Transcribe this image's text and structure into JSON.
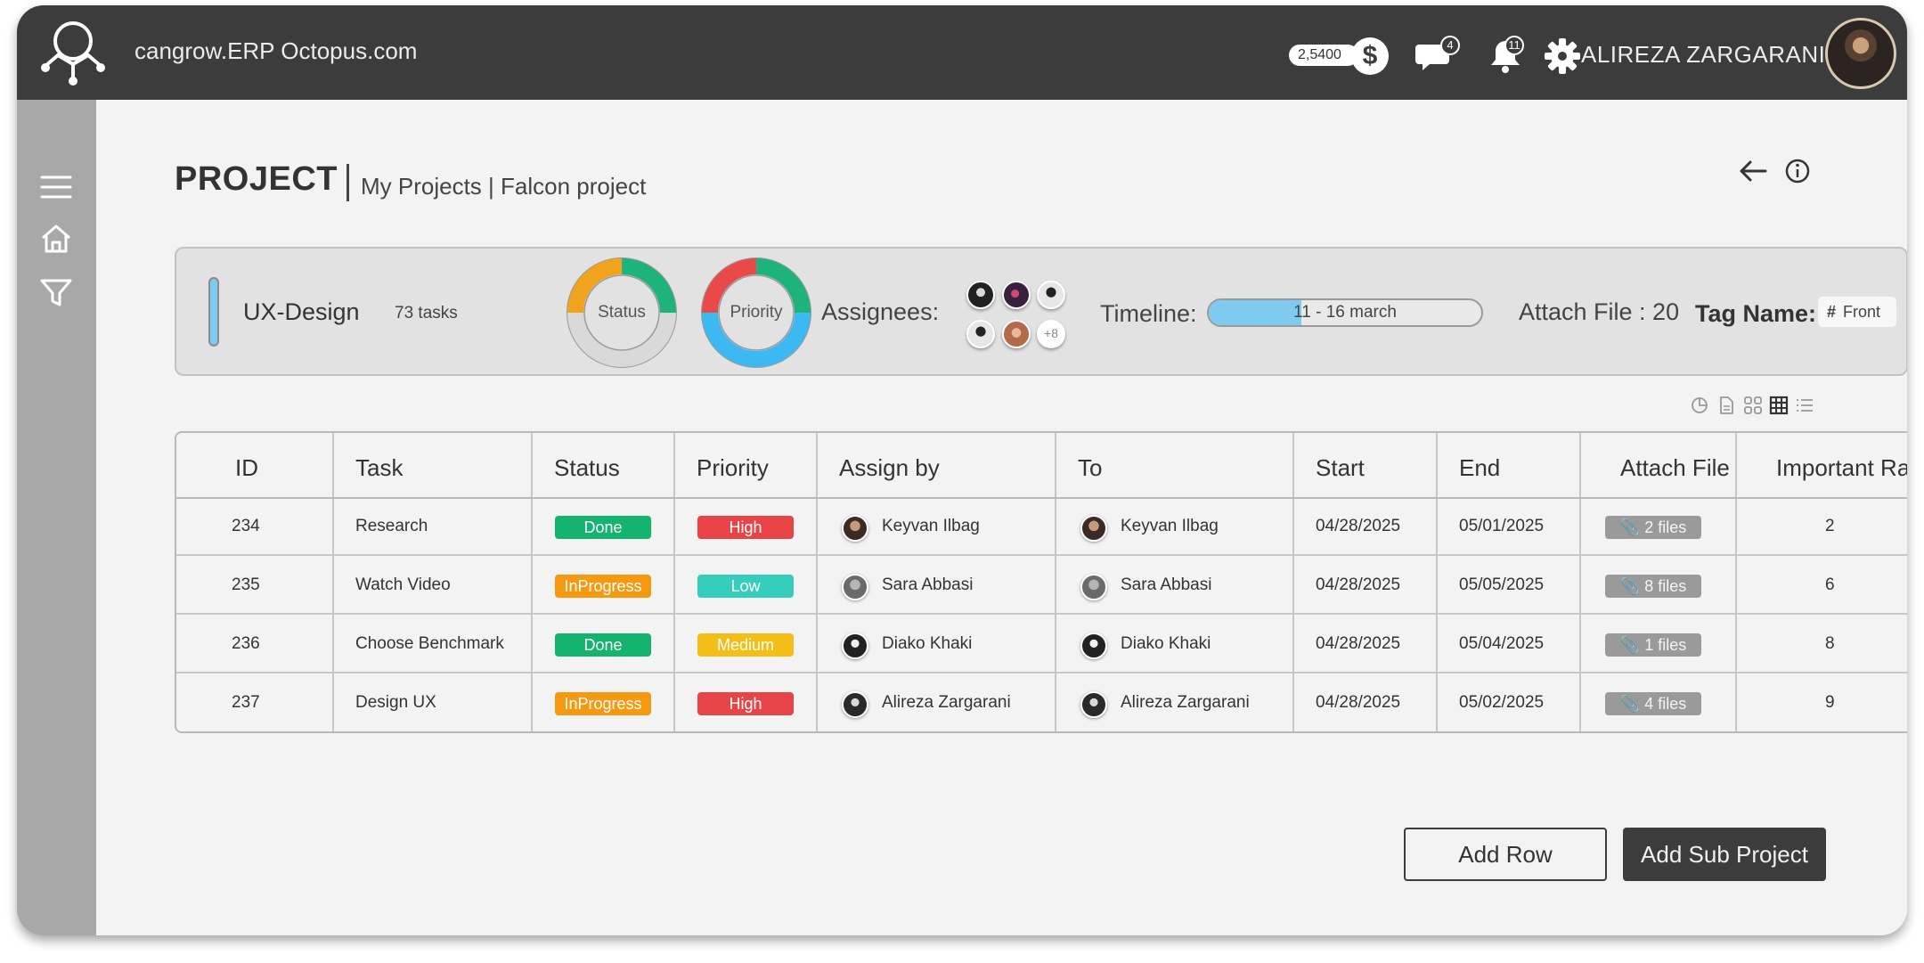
{
  "header": {
    "app_title": "cangrow.ERP Octopus.com",
    "coins": "2,5400",
    "coin_symbol": "$",
    "messages_badge": "4",
    "notifications_badge": "11",
    "user_name": "ALIREZA ZARGARANI"
  },
  "page": {
    "title": "PROJECT",
    "breadcrumb": "My Projects | Falcon project"
  },
  "project": {
    "group_name": "UX-Design",
    "task_count": "73 tasks",
    "status_label": "Status",
    "priority_label": "Priority",
    "assignees_label": "Assignees:",
    "assignees_more": "+8",
    "timeline_label": "Timeline:",
    "timeline_range": "11 - 16 march",
    "timeline_progress": 0.34,
    "attach_label": "Attach File : 20",
    "tag_label": "Tag Name:",
    "tag_value": "Front",
    "tag_hash": "#",
    "accent_color": "#7fcbf0",
    "status_chart": [
      {
        "name": "orange",
        "value": 25,
        "color": "#f2a31e"
      },
      {
        "name": "green",
        "value": 25,
        "color": "#1eb37a"
      },
      {
        "name": "grey",
        "value": 50,
        "color": "#d9d9d9"
      }
    ],
    "priority_chart": [
      {
        "name": "red",
        "value": 25,
        "color": "#e84a4a"
      },
      {
        "name": "green",
        "value": 25,
        "color": "#1eb37a"
      },
      {
        "name": "blue",
        "value": 50,
        "color": "#3cb9f2"
      }
    ]
  },
  "table": {
    "headers": [
      "ID",
      "Task",
      "Status",
      "Priority",
      "Assign by",
      "To",
      "Start",
      "End",
      "Attach File",
      "Important Rate"
    ],
    "rows": [
      {
        "id": "234",
        "task": "Research",
        "status": "Done",
        "status_color": "#14b36e",
        "priority": "High",
        "priority_color": "#e84347",
        "assign_by": "Keyvan Ilbag",
        "to": "Keyvan Ilbag",
        "start": "04/28/2025",
        "end": "05/01/2025",
        "files": "2 files",
        "rate": "2"
      },
      {
        "id": "235",
        "task": "Watch Video",
        "status": "InProgress",
        "status_color": "#f59a10",
        "priority": "Low",
        "priority_color": "#35cdbc",
        "assign_by": "Sara Abbasi",
        "to": "Sara Abbasi",
        "start": "04/28/2025",
        "end": "05/05/2025",
        "files": "8 files",
        "rate": "6"
      },
      {
        "id": "236",
        "task": "Choose Benchmark",
        "status": "Done",
        "status_color": "#14b36e",
        "priority": "Medium",
        "priority_color": "#f5bd18",
        "assign_by": "Diako Khaki",
        "to": "Diako Khaki",
        "start": "04/28/2025",
        "end": "05/04/2025",
        "files": "1 files",
        "rate": "8"
      },
      {
        "id": "237",
        "task": "Design UX",
        "status": "InProgress",
        "status_color": "#f59a10",
        "priority": "High",
        "priority_color": "#e84347",
        "assign_by": "Alireza Zargarani",
        "to": "Alireza Zargarani",
        "start": "04/28/2025",
        "end": "05/02/2025",
        "files": "4 files",
        "rate": "9"
      }
    ]
  },
  "actions": {
    "add_row": "Add Row",
    "add_sub_project": "Add Sub Project"
  },
  "icons": {
    "logo": "octopus-logo-icon",
    "coin": "dollar-icon",
    "chat": "chat-icon",
    "bell": "bell-icon",
    "settings": "gear-icon",
    "menu": "hamburger-icon",
    "home": "home-icon",
    "filter": "filter-icon",
    "back": "arrow-left-icon",
    "info": "info-icon",
    "attach": "paperclip-icon"
  }
}
